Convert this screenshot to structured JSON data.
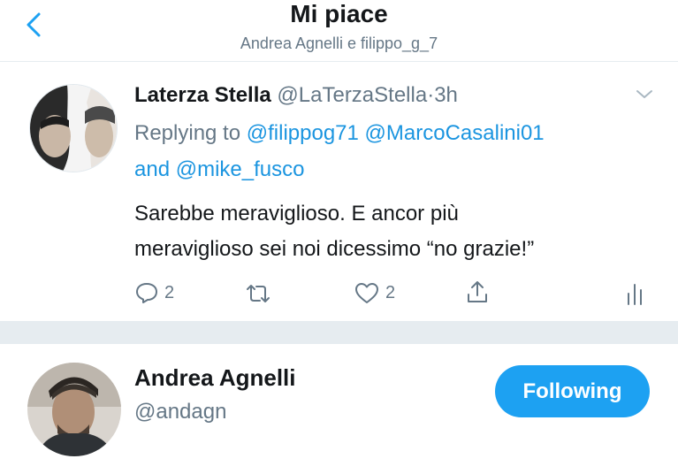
{
  "header": {
    "title": "Mi piace",
    "subtitle": "Andrea Agnelli e filippo_g_7"
  },
  "tweet": {
    "author": "Laterza Stella",
    "handle": "@LaTerzaStella",
    "separator": "·",
    "time": "3h",
    "replying_prefix": "Replying to",
    "mentions": [
      "@filippog71",
      "@MarcoCasalini01",
      "@mike_fusco"
    ],
    "and_word": "and",
    "text_lines": [
      "Sarebbe meraviglioso. E ancor più",
      "meraviglioso sei noi dicessimo “no grazie!”"
    ],
    "reply_count": "2",
    "like_count": "2"
  },
  "user_card": {
    "name": "Andrea Agnelli",
    "handle": "@andagn",
    "follow_label": "Following"
  },
  "colors": {
    "accent": "#1da1f2",
    "link": "#1b95e0",
    "muted": "#657786",
    "separator": "#e6ecf0"
  },
  "icons": {
    "back": "chevron-left-icon",
    "more": "chevron-down-icon",
    "reply": "reply-icon",
    "retweet": "retweet-icon",
    "like": "heart-icon",
    "share": "share-icon",
    "analytics": "analytics-icon"
  }
}
